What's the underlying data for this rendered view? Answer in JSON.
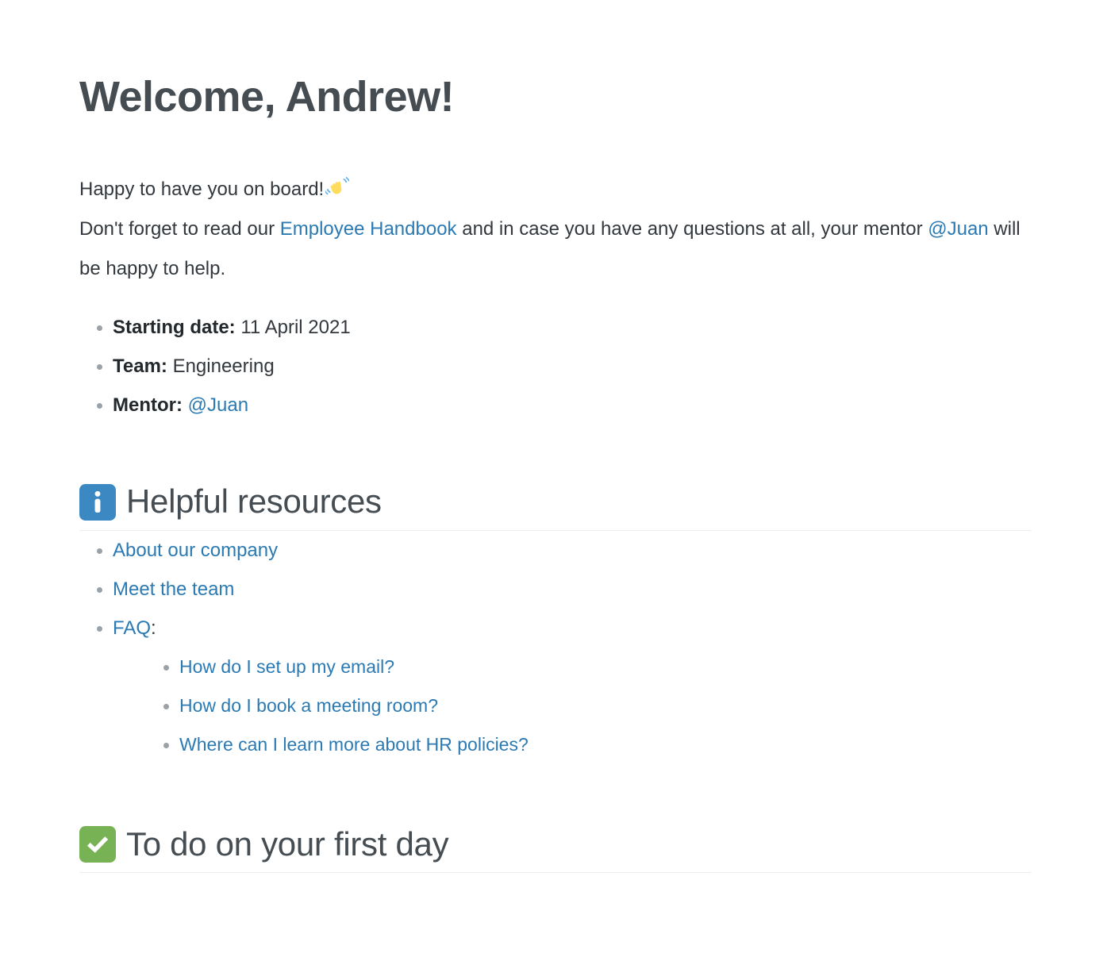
{
  "document": {
    "title": "Welcome, Andrew!",
    "intro": {
      "line1_text": "Happy to have you on board!",
      "line1_emoji": "waving-hand-emoji",
      "line2_part1": "Don't forget to read our ",
      "line2_link": "Employee Handbook",
      "line2_part2": " and in case you have any questions at all, your mentor ",
      "line2_mention": "@Juan",
      "line2_part3": " will be happy to help."
    },
    "details": [
      {
        "label": "Starting date:",
        "value": "11 April 2021",
        "is_link": false
      },
      {
        "label": "Team:",
        "value": "Engineering",
        "is_link": false
      },
      {
        "label": "Mentor:",
        "value": "@Juan",
        "is_link": true
      }
    ],
    "sections": [
      {
        "icon": "information-source-emoji",
        "icon_color": "#3b88c3",
        "title": "Helpful resources",
        "links": [
          {
            "label": "About our company",
            "suffix": ""
          },
          {
            "label": "Meet the team",
            "suffix": ""
          },
          {
            "label": "FAQ",
            "suffix": ":"
          }
        ],
        "sub_links": [
          "How do I set up my email?",
          "How do I book a meeting room?",
          "Where can I learn more about HR policies?"
        ]
      },
      {
        "icon": "white-check-mark-emoji",
        "icon_color": "#77b255",
        "title": "To do on your first day"
      }
    ]
  },
  "colors": {
    "link": "#2b7ab3",
    "heading": "#454d52",
    "body_text": "#32383d",
    "bullet": "#9aa2a8",
    "divider": "#eceef0",
    "info_badge": "#3b88c3",
    "check_badge": "#77b255",
    "wave_hand": "#ffdc5d",
    "wave_lines": "#5dadec"
  }
}
